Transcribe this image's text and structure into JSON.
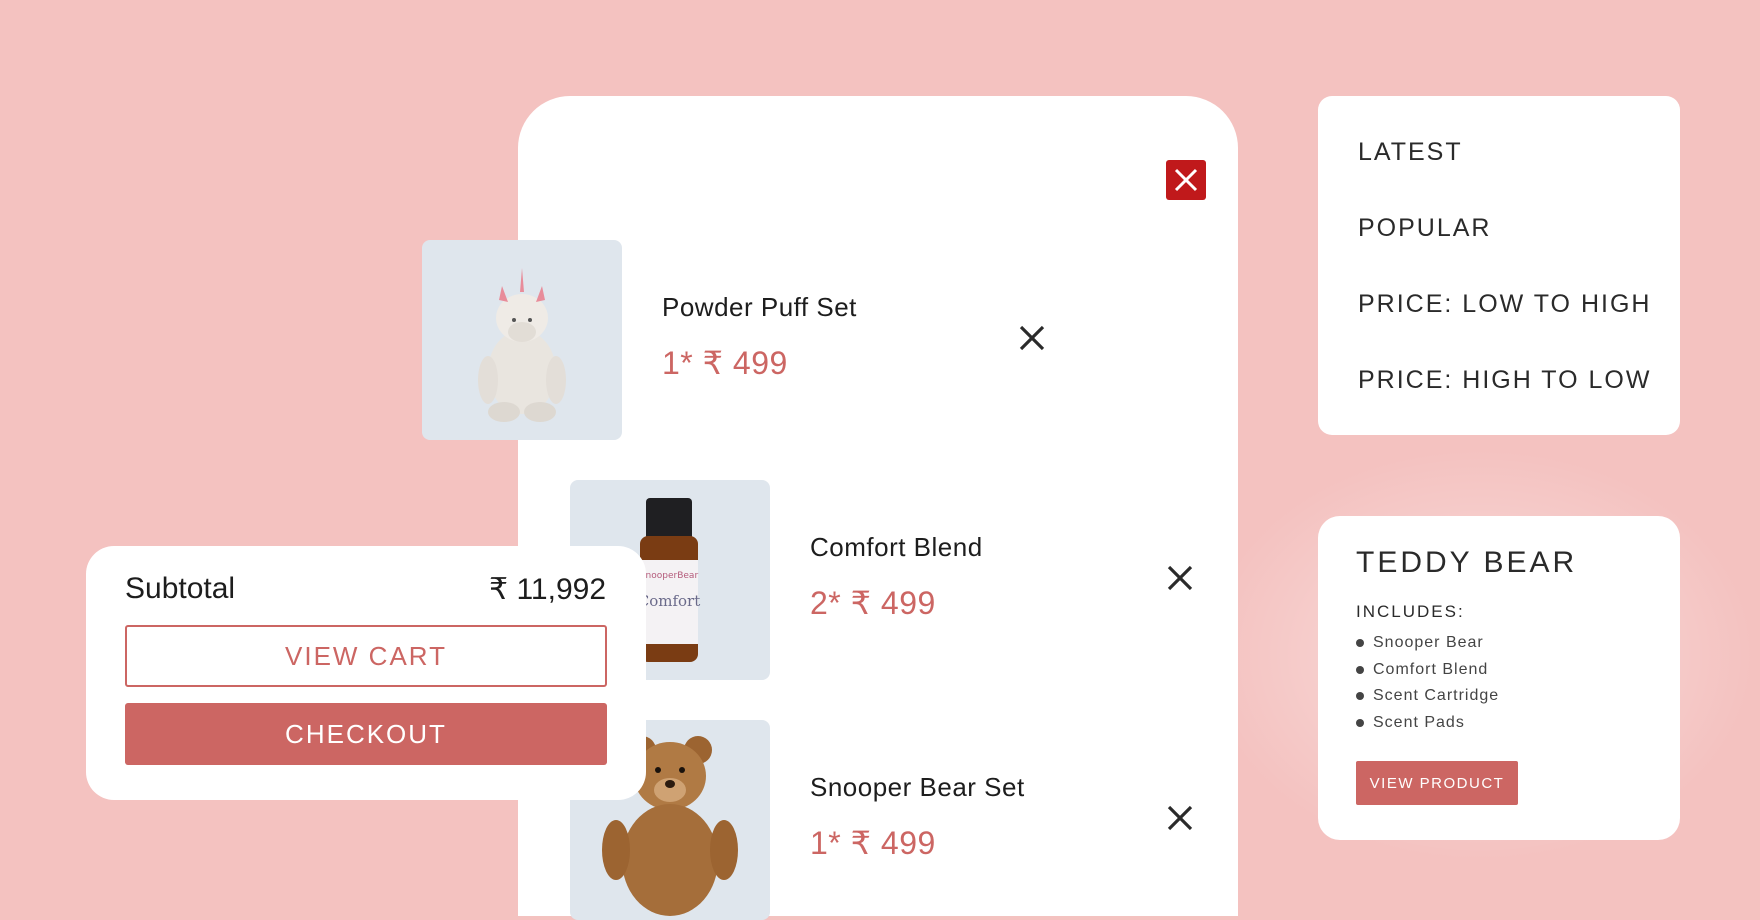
{
  "cart": {
    "items": [
      {
        "name": "Powder Puff Set",
        "price": "1* ₹ 499",
        "image": "white-unicorn-plush-image"
      },
      {
        "name": "Comfort Blend",
        "price": "2* ₹ 499",
        "image": "comfort-oil-bottle-image",
        "bottle_label_brand": "SnooperBear",
        "bottle_label_name": "Comfort"
      },
      {
        "name": "Snooper Bear Set",
        "price": "1* ₹ 499",
        "image": "brown-teddy-bear-image"
      }
    ]
  },
  "summary": {
    "subtotal_label": "Subtotal",
    "subtotal_value": "₹ 11,992",
    "view_cart_label": "VIEW CART",
    "checkout_label": "CHECKOUT"
  },
  "sort_menu": {
    "options": [
      "LATEST",
      "POPULAR",
      "PRICE: LOW TO HIGH",
      "PRICE: HIGH TO LOW"
    ]
  },
  "product_card": {
    "title": "TEDDY BEAR",
    "includes_label": "INCLUDES:",
    "includes": [
      "Snooper Bear",
      "Comfort Blend",
      "Scent Cartridge",
      "Scent Pads"
    ],
    "button_label": "VIEW PRODUCT"
  },
  "colors": {
    "background": "#f4c2c0",
    "accent": "#cc6663",
    "close_button": "#c0191b",
    "image_bg": "#dfe6ed"
  },
  "icons": {
    "close": "close-icon",
    "remove": "remove-item-icon"
  }
}
